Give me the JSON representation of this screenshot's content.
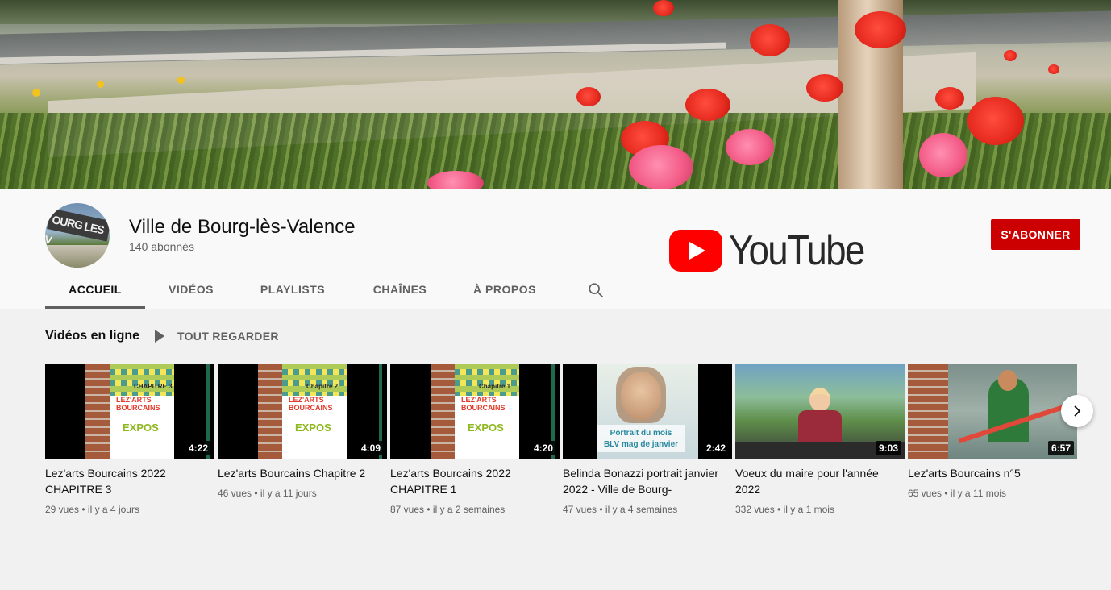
{
  "channel": {
    "name": "Ville de Bourg-lès-Valence",
    "subscribers": "140 abonnés",
    "avatar_text": "OURG LES V",
    "subscribe_label": "S'ABONNER",
    "logo_wordmark": "YouTube"
  },
  "tabs": [
    {
      "label": "ACCUEIL",
      "active": true
    },
    {
      "label": "VIDÉOS",
      "active": false
    },
    {
      "label": "PLAYLISTS",
      "active": false
    },
    {
      "label": "CHAÎNES",
      "active": false
    },
    {
      "label": "À PROPOS",
      "active": false
    }
  ],
  "shelf": {
    "title": "Vidéos en ligne",
    "play_all_label": "TOUT REGARDER"
  },
  "videos": [
    {
      "title": "Lez'arts Bourcains 2022 CHAPITRE 3",
      "duration": "4:22",
      "views": "29 vues",
      "age": "il y a 4 jours",
      "poster_top": "CHAPITRE 3",
      "poster_mid": "LEZ'ARTS BOURCAINS",
      "poster_bottom": "EXPOS"
    },
    {
      "title": "Lez'arts Bourcains Chapitre 2",
      "duration": "4:09",
      "views": "46 vues",
      "age": "il y a 11 jours",
      "poster_top": "Chapitre 2",
      "poster_mid": "LEZ'ARTS BOURCAINS",
      "poster_bottom": "EXPOS"
    },
    {
      "title": "Lez'arts Bourcains 2022 CHAPITRE 1",
      "duration": "4:20",
      "views": "87 vues",
      "age": "il y a 2 semaines",
      "poster_top": "Chapitre 1",
      "poster_mid": "LEZ'ARTS BOURCAINS",
      "poster_bottom": "EXPOS"
    },
    {
      "title": "Belinda Bonazzi portrait janvier 2022 - Ville de Bourg-",
      "duration": "2:42",
      "views": "47 vues",
      "age": "il y a 4 semaines",
      "caption_line1": "Portrait du mois",
      "caption_line2": "BLV mag de janvier"
    },
    {
      "title": "Voeux du maire pour l'année 2022",
      "duration": "9:03",
      "views": "332 vues",
      "age": "il y a 1 mois"
    },
    {
      "title": "Lez'arts Bourcains n°5",
      "duration": "6:57",
      "views": "65 vues",
      "age": "il y a 11 mois"
    }
  ],
  "meta_separator": "•",
  "icons": {
    "search": "search-icon",
    "next": "chevron-right-icon",
    "play_all": "play-icon",
    "logo": "youtube-play-icon"
  },
  "colors": {
    "subscribe_bg": "#cc0000",
    "youtube_red": "#ff0000",
    "page_bg": "#f1f1f1",
    "header_bg": "#f9f9f9",
    "muted_text": "#606060"
  }
}
